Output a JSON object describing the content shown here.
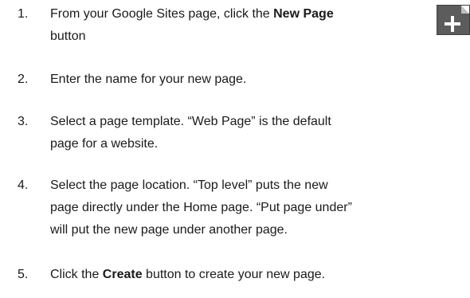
{
  "steps": [
    {
      "number": "1.",
      "lines": [
        {
          "before": "From your Google Sites page, click the ",
          "bold": "New Page",
          "after": ""
        },
        {
          "before": "button",
          "bold": "",
          "after": ""
        }
      ],
      "icon": "new-page-plus-icon"
    },
    {
      "number": "2.",
      "lines": [
        {
          "before": "Enter the name for your new page.",
          "bold": "",
          "after": ""
        }
      ]
    },
    {
      "number": "3.",
      "lines": [
        {
          "before": "Select a page template. “Web Page” is the default",
          "bold": "",
          "after": ""
        },
        {
          "before": "page for a website.",
          "bold": "",
          "after": ""
        }
      ]
    },
    {
      "number": "4.",
      "lines": [
        {
          "before": "Select the page location. “Top level” puts the new",
          "bold": "",
          "after": ""
        },
        {
          "before": "page directly under the Home page.  “Put page under”",
          "bold": "",
          "after": ""
        },
        {
          "before": "will put the new page under another page.",
          "bold": "",
          "after": ""
        }
      ]
    },
    {
      "number": "5.",
      "lines": [
        {
          "before": "Click the ",
          "bold": "Create",
          "after": " button to create your new page."
        }
      ]
    }
  ]
}
